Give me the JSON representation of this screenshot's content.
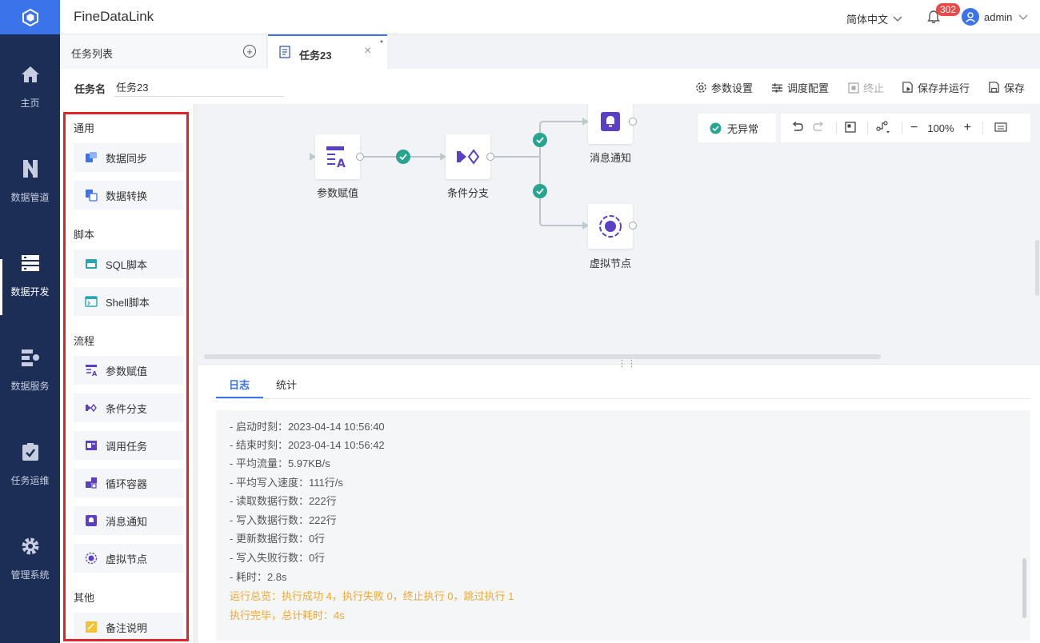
{
  "nav": {
    "items": [
      {
        "label": "主页",
        "icon": "home-icon"
      },
      {
        "label": "数据管道",
        "icon": "pipeline-icon"
      },
      {
        "label": "数据开发",
        "icon": "dev-icon",
        "active": true
      },
      {
        "label": "数据服务",
        "icon": "service-icon"
      },
      {
        "label": "任务运维",
        "icon": "ops-icon"
      },
      {
        "label": "管理系统",
        "icon": "gear-icon"
      }
    ]
  },
  "header": {
    "app_title": "FineDataLink",
    "language": "简体中文",
    "notification_count": "302",
    "username": "admin"
  },
  "tabs": {
    "task_list_label": "任务列表",
    "active_tab": "任务23",
    "unsaved_mark": "*"
  },
  "toolbar": {
    "task_name_label": "任务名",
    "task_name_value": "任务23",
    "params_settings": "参数设置",
    "schedule_config": "调度配置",
    "stop": "终止",
    "save_and_run": "保存并运行",
    "save": "保存"
  },
  "panel": {
    "sections": [
      {
        "title": "通用",
        "items": [
          "数据同步",
          "数据转换"
        ]
      },
      {
        "title": "脚本",
        "items": [
          "SQL脚本",
          "Shell脚本"
        ]
      },
      {
        "title": "流程",
        "items": [
          "参数赋值",
          "条件分支",
          "调用任务",
          "循环容器",
          "消息通知",
          "虚拟节点"
        ]
      },
      {
        "title": "其他",
        "items": [
          "备注说明"
        ]
      }
    ]
  },
  "canvas": {
    "nodes": {
      "param": "参数赋值",
      "branch": "条件分支",
      "message": "消息通知",
      "virtual": "虚拟节点"
    },
    "status": "无异常",
    "zoom": "100%"
  },
  "log": {
    "tabs": [
      "日志",
      "统计"
    ],
    "lines": [
      "- 启动时刻：2023-04-14 10:56:40",
      "- 结束时刻：2023-04-14 10:56:42",
      "- 平均流量：5.97KB/s",
      "- 平均写入速度：111行/s",
      "- 读取数据行数：222行",
      "- 写入数据行数：222行",
      "- 更新数据行数：0行",
      "- 写入失败行数：0行",
      "- 耗时：2.8s"
    ],
    "summary": "运行总览：执行成功 4，执行失败 0，终止执行 0，跳过执行 1",
    "finish": "执行完毕，总计耗时：4s"
  },
  "colors": {
    "nav_bg": "#1c2e55",
    "accent": "#3a73ea",
    "node_icon": "#5b3fc4",
    "success": "#29a58f",
    "warning_text": "#f0a830",
    "highlight_border": "#e0242b"
  }
}
